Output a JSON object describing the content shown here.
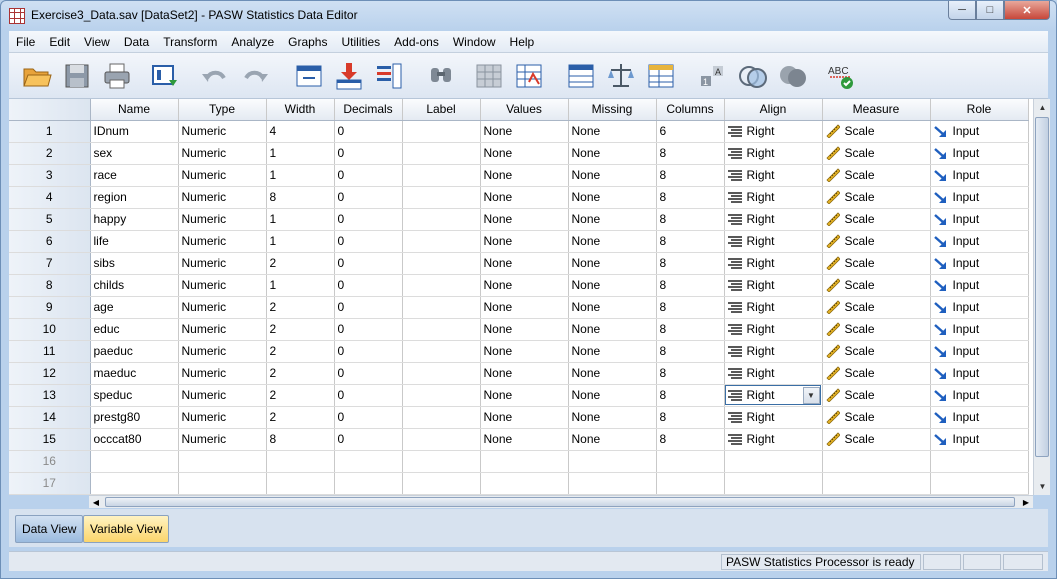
{
  "window": {
    "title": "Exercise3_Data.sav [DataSet2] - PASW Statistics Data Editor",
    "minimize": "─",
    "maximize": "□",
    "close": "✕"
  },
  "menu": [
    "File",
    "Edit",
    "View",
    "Data",
    "Transform",
    "Analyze",
    "Graphs",
    "Utilities",
    "Add-ons",
    "Window",
    "Help"
  ],
  "toolbar_icons": [
    "open-folder-icon",
    "save-icon",
    "print-icon",
    "dialog-recall-icon",
    "undo-icon",
    "redo-icon",
    "goto-case-icon",
    "goto-variable-icon",
    "variables-icon",
    "find-icon",
    "insert-cases-icon",
    "insert-variable-icon",
    "split-file-icon",
    "weight-cases-icon",
    "select-cases-icon",
    "value-labels-icon",
    "use-sets-icon",
    "show-all-variables-icon",
    "spell-check-icon"
  ],
  "columns": [
    "Name",
    "Type",
    "Width",
    "Decimals",
    "Label",
    "Values",
    "Missing",
    "Columns",
    "Align",
    "Measure",
    "Role"
  ],
  "rows": [
    {
      "num": "1",
      "name": "IDnum",
      "type": "Numeric",
      "width": "4",
      "decimals": "0",
      "label": "",
      "values": "None",
      "missing": "None",
      "columns": "6",
      "align": "Right",
      "measure": "Scale",
      "role": "Input"
    },
    {
      "num": "2",
      "name": "sex",
      "type": "Numeric",
      "width": "1",
      "decimals": "0",
      "label": "",
      "values": "None",
      "missing": "None",
      "columns": "8",
      "align": "Right",
      "measure": "Scale",
      "role": "Input"
    },
    {
      "num": "3",
      "name": "race",
      "type": "Numeric",
      "width": "1",
      "decimals": "0",
      "label": "",
      "values": "None",
      "missing": "None",
      "columns": "8",
      "align": "Right",
      "measure": "Scale",
      "role": "Input"
    },
    {
      "num": "4",
      "name": "region",
      "type": "Numeric",
      "width": "8",
      "decimals": "0",
      "label": "",
      "values": "None",
      "missing": "None",
      "columns": "8",
      "align": "Right",
      "measure": "Scale",
      "role": "Input"
    },
    {
      "num": "5",
      "name": "happy",
      "type": "Numeric",
      "width": "1",
      "decimals": "0",
      "label": "",
      "values": "None",
      "missing": "None",
      "columns": "8",
      "align": "Right",
      "measure": "Scale",
      "role": "Input"
    },
    {
      "num": "6",
      "name": "life",
      "type": "Numeric",
      "width": "1",
      "decimals": "0",
      "label": "",
      "values": "None",
      "missing": "None",
      "columns": "8",
      "align": "Right",
      "measure": "Scale",
      "role": "Input"
    },
    {
      "num": "7",
      "name": "sibs",
      "type": "Numeric",
      "width": "2",
      "decimals": "0",
      "label": "",
      "values": "None",
      "missing": "None",
      "columns": "8",
      "align": "Right",
      "measure": "Scale",
      "role": "Input"
    },
    {
      "num": "8",
      "name": "childs",
      "type": "Numeric",
      "width": "1",
      "decimals": "0",
      "label": "",
      "values": "None",
      "missing": "None",
      "columns": "8",
      "align": "Right",
      "measure": "Scale",
      "role": "Input"
    },
    {
      "num": "9",
      "name": "age",
      "type": "Numeric",
      "width": "2",
      "decimals": "0",
      "label": "",
      "values": "None",
      "missing": "None",
      "columns": "8",
      "align": "Right",
      "measure": "Scale",
      "role": "Input"
    },
    {
      "num": "10",
      "name": "educ",
      "type": "Numeric",
      "width": "2",
      "decimals": "0",
      "label": "",
      "values": "None",
      "missing": "None",
      "columns": "8",
      "align": "Right",
      "measure": "Scale",
      "role": "Input"
    },
    {
      "num": "11",
      "name": "paeduc",
      "type": "Numeric",
      "width": "2",
      "decimals": "0",
      "label": "",
      "values": "None",
      "missing": "None",
      "columns": "8",
      "align": "Right",
      "measure": "Scale",
      "role": "Input"
    },
    {
      "num": "12",
      "name": "maeduc",
      "type": "Numeric",
      "width": "2",
      "decimals": "0",
      "label": "",
      "values": "None",
      "missing": "None",
      "columns": "8",
      "align": "Right",
      "measure": "Scale",
      "role": "Input"
    },
    {
      "num": "13",
      "name": "speduc",
      "type": "Numeric",
      "width": "2",
      "decimals": "0",
      "label": "",
      "values": "None",
      "missing": "None",
      "columns": "8",
      "align": "Right",
      "measure": "Scale",
      "role": "Input"
    },
    {
      "num": "14",
      "name": "prestg80",
      "type": "Numeric",
      "width": "2",
      "decimals": "0",
      "label": "",
      "values": "None",
      "missing": "None",
      "columns": "8",
      "align": "Right",
      "measure": "Scale",
      "role": "Input"
    },
    {
      "num": "15",
      "name": "occcat80",
      "type": "Numeric",
      "width": "8",
      "decimals": "0",
      "label": "",
      "values": "None",
      "missing": "None",
      "columns": "8",
      "align": "Right",
      "measure": "Scale",
      "role": "Input"
    }
  ],
  "empty_rows": [
    "16",
    "17"
  ],
  "selected_row": "13",
  "tabs": {
    "data_view": "Data View",
    "variable_view": "Variable View",
    "active": "Variable View"
  },
  "status": {
    "text": "PASW Statistics Processor is ready"
  },
  "colors": {
    "active_tab": "#fbd56b",
    "measure_icon": "#d4a017",
    "role_icon": "#1f5fbf"
  }
}
